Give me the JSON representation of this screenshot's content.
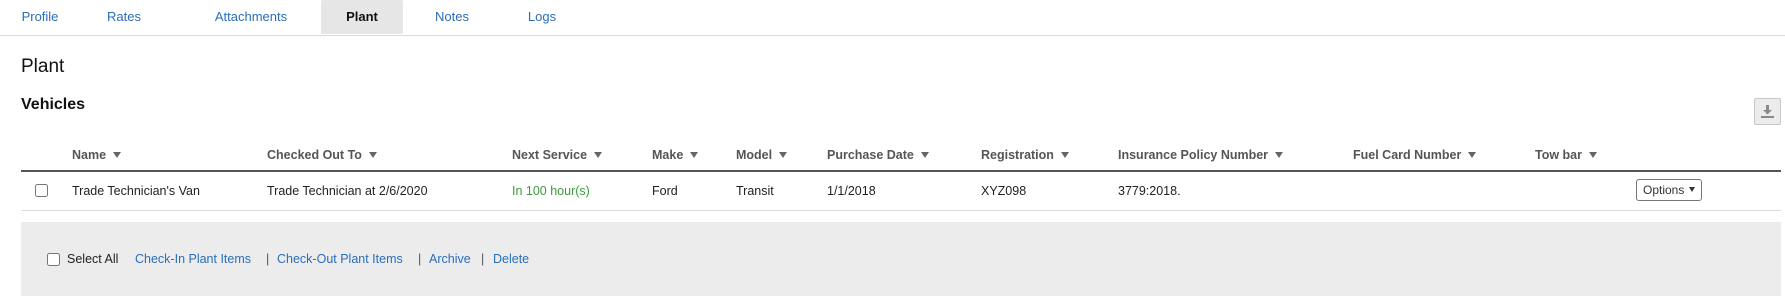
{
  "tabs": [
    {
      "label": "Profile",
      "active": false
    },
    {
      "label": "Rates",
      "active": false
    },
    {
      "label": "Attachments",
      "active": false
    },
    {
      "label": "Plant",
      "active": true
    },
    {
      "label": "Notes",
      "active": false
    },
    {
      "label": "Logs",
      "active": false
    }
  ],
  "page": {
    "title": "Plant",
    "section_title": "Vehicles",
    "download_icon": "download-icon"
  },
  "table": {
    "columns": [
      "Name",
      "Checked Out To",
      "Next Service",
      "Make",
      "Model",
      "Purchase Date",
      "Registration",
      "Insurance Policy Number",
      "Fuel Card Number",
      "Tow bar"
    ],
    "rows": [
      {
        "name": "Trade Technician's Van",
        "checked_out_to": "Trade Technician at 2/6/2020",
        "next_service": "In 100 hour(s)",
        "make": "Ford",
        "model": "Transit",
        "purchase_date": "1/1/2018",
        "registration": "XYZ098",
        "insurance_policy_number": "3779:2018.",
        "fuel_card_number": "",
        "tow_bar": "",
        "options_label": "Options"
      }
    ]
  },
  "footer": {
    "select_all": "Select All",
    "check_in": "Check-In Plant Items",
    "check_out": "Check-Out Plant Items",
    "archive": "Archive",
    "delete": "Delete",
    "separator": "|"
  },
  "colors": {
    "link": "#2a6ebb",
    "service_ok": "#3c9a3c",
    "active_tab_bg": "#e6e6e6",
    "footer_bg": "#ececec"
  }
}
